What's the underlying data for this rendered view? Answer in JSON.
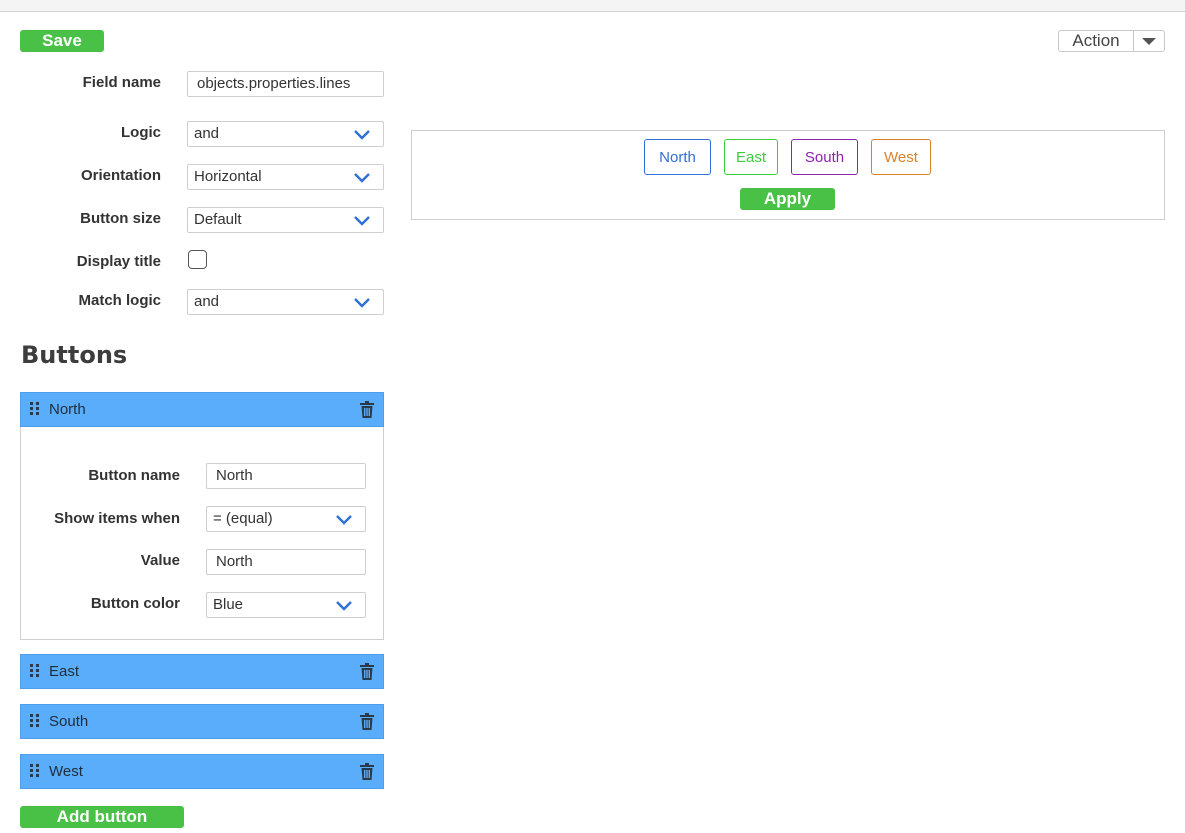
{
  "toolbar": {
    "save_label": "Save",
    "action_label": "Action"
  },
  "form": {
    "field_name": {
      "label": "Field name",
      "value": "objects.properties.lines"
    },
    "logic": {
      "label": "Logic",
      "value": "and"
    },
    "orientation": {
      "label": "Orientation",
      "value": "Horizontal"
    },
    "button_size": {
      "label": "Button size",
      "value": "Default"
    },
    "display_title": {
      "label": "Display title",
      "checked": false
    },
    "match_logic": {
      "label": "Match logic",
      "value": "and"
    }
  },
  "buttons_section": {
    "heading": "Buttons",
    "items": [
      {
        "title": "North",
        "expanded": true,
        "button_name": {
          "label": "Button name",
          "value": "North"
        },
        "show_items_when": {
          "label": "Show items when",
          "value": "= (equal)"
        },
        "value": {
          "label": "Value",
          "value": "North"
        },
        "button_color": {
          "label": "Button color",
          "value": "Blue"
        }
      },
      {
        "title": "East"
      },
      {
        "title": "South"
      },
      {
        "title": "West"
      }
    ],
    "add_label": "Add button"
  },
  "preview": {
    "buttons": [
      {
        "label": "North",
        "color": "#2f6fd6"
      },
      {
        "label": "East",
        "color": "#3fcb3f"
      },
      {
        "label": "South",
        "color": "#8e24aa"
      },
      {
        "label": "West",
        "color": "#d9822b"
      }
    ],
    "apply_label": "Apply"
  },
  "colors": {
    "accent_green": "#49c046",
    "panel_blue": "#5aadfa",
    "chevron_blue": "#2f6fd6"
  }
}
